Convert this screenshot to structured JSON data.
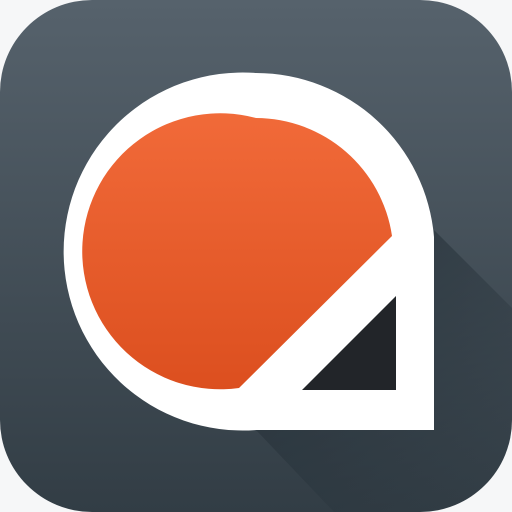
{
  "icon": {
    "name": "app-icon",
    "colors": {
      "tile_top": "#56626c",
      "tile_bottom": "#323d45",
      "shadow": "#27323a",
      "ring": "#ffffff",
      "orange_top": "#f16a39",
      "orange_bottom": "#dc4f1f",
      "dark_triangle": "#222529",
      "outer_corner": "#ffffff"
    }
  }
}
